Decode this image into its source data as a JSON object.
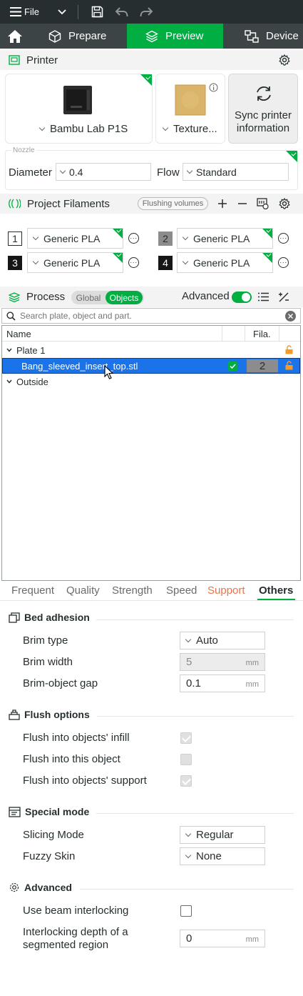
{
  "titlebar": {
    "menu_label": "File"
  },
  "nav": {
    "prepare": "Prepare",
    "preview": "Preview",
    "device": "Device"
  },
  "printer": {
    "section_title": "Printer",
    "printer_name": "Bambu Lab P1S",
    "plate_name": "Texture...",
    "sync_label_1": "Sync printer",
    "sync_label_2": "information",
    "nozzle_legend": "Nozzle",
    "diameter_label": "Diameter",
    "diameter_value": "0.4",
    "flow_label": "Flow",
    "flow_value": "Standard"
  },
  "filaments": {
    "section_title": "Project Filaments",
    "flushing_button": "Flushing volumes",
    "items": [
      {
        "num": "1",
        "name": "Generic PLA",
        "color": "#ffffff",
        "text_color": "#262e30"
      },
      {
        "num": "2",
        "name": "Generic PLA",
        "color": "#8c8c8c",
        "text_color": "#262e30"
      },
      {
        "num": "3",
        "name": "Generic PLA",
        "color": "#161616",
        "text_color": "#ffffff"
      },
      {
        "num": "4",
        "name": "Generic PLA",
        "color": "#161616",
        "text_color": "#ffffff"
      }
    ]
  },
  "process": {
    "section_title": "Process",
    "toggle_global": "Global",
    "toggle_objects": "Objects",
    "advanced_label": "Advanced",
    "advanced_on": true
  },
  "search": {
    "placeholder": "Search plate, object and part."
  },
  "tree": {
    "col_name": "Name",
    "col_fila": "Fila.",
    "plate_label": "Plate 1",
    "object_name": "Bang_sleeved_insert_top.stl",
    "object_filament": "2",
    "outside_label": "Outside"
  },
  "tabs": {
    "frequent": "Frequent",
    "quality": "Quality",
    "strength": "Strength",
    "speed": "Speed",
    "support": "Support",
    "others": "Others",
    "active": "Others"
  },
  "bed_adhesion": {
    "title": "Bed adhesion",
    "brim_type_label": "Brim type",
    "brim_type_value": "Auto",
    "brim_width_label": "Brim width",
    "brim_width_value": "5",
    "brim_gap_label": "Brim-object gap",
    "brim_gap_value": "0.1",
    "unit": "mm"
  },
  "flush_options": {
    "title": "Flush options",
    "infill_label": "Flush into objects' infill",
    "infill_checked": true,
    "object_label": "Flush into this object",
    "object_checked": false,
    "support_label": "Flush into objects' support",
    "support_checked": true
  },
  "special_mode": {
    "title": "Special mode",
    "slicing_label": "Slicing Mode",
    "slicing_value": "Regular",
    "fuzzy_label": "Fuzzy Skin",
    "fuzzy_value": "None"
  },
  "advanced": {
    "title": "Advanced",
    "beam_label": "Use beam interlocking",
    "beam_checked": false,
    "depth_label_1": "Interlocking depth of a",
    "depth_label_2": "segmented region",
    "depth_value": "0",
    "unit": "mm"
  },
  "colors": {
    "accent": "#00ae42",
    "dark": "#262e30",
    "selection": "#1a73e8",
    "support_tab": "#e8734a",
    "lock": "#f59a23"
  }
}
